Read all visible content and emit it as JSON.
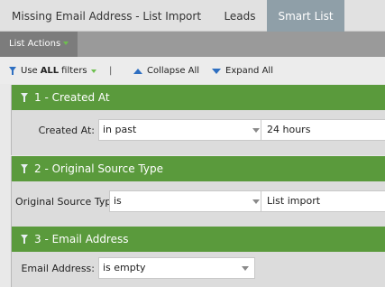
{
  "tabs": {
    "title": "Missing Email Address - List Import (...",
    "leads": "Leads",
    "smart_list": "Smart List"
  },
  "actions": {
    "list_actions": "List Actions"
  },
  "toolbar": {
    "use_prefix": "Use",
    "use_all": "ALL",
    "use_suffix": "filters",
    "separator": "|",
    "collapse_all": "Collapse All",
    "expand_all": "Expand All"
  },
  "filters": [
    {
      "header": "1 - Created At",
      "label": "Created At:",
      "operator": "in past",
      "value": "24 hours"
    },
    {
      "header": "2 - Original Source Type",
      "label": "Original Source Type:",
      "operator": "is",
      "value": "List import"
    },
    {
      "header": "3 - Email Address",
      "label": "Email Address:",
      "operator": "is empty"
    }
  ],
  "colors": {
    "filter_header": "#5a9a3c",
    "active_tab": "#8f9fa8",
    "link_icon": "#2e6fc1",
    "dropdown_accent": "#6ec04f"
  },
  "icons": {
    "filter_header": "drag-handle-icon",
    "use_filters": "funnel-icon",
    "collapse": "triangle-up-icon",
    "expand": "triangle-down-icon"
  }
}
